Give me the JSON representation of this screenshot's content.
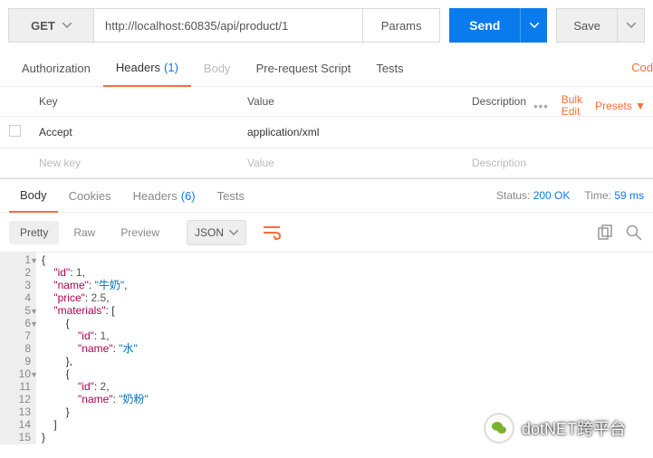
{
  "toolbar": {
    "method": "GET",
    "url": "http://localhost:60835/api/product/1",
    "params_label": "Params",
    "send_label": "Send",
    "save_label": "Save"
  },
  "request_tabs": {
    "authorization": "Authorization",
    "headers": "Headers",
    "headers_count": "(1)",
    "body": "Body",
    "prerequest": "Pre-request Script",
    "tests": "Tests",
    "code_link": "Cod"
  },
  "header_table": {
    "col_key": "Key",
    "col_value": "Value",
    "col_desc": "Description",
    "bulk_edit": "Bulk\nEdit",
    "presets": "Presets ▼",
    "rows": [
      {
        "key": "Accept",
        "value": "application/xml",
        "desc": ""
      }
    ],
    "placeholder": {
      "key": "New key",
      "value": "Value",
      "desc": "Description"
    }
  },
  "response_tabs": {
    "body": "Body",
    "cookies": "Cookies",
    "headers": "Headers",
    "headers_count": "(6)",
    "tests": "Tests",
    "status_label": "Status:",
    "status_value": "200 OK",
    "time_label": "Time:",
    "time_value": "59 ms"
  },
  "view_bar": {
    "pretty": "Pretty",
    "raw": "Raw",
    "preview": "Preview",
    "format": "JSON"
  },
  "code_lines": [
    [
      [
        "punc",
        "{"
      ]
    ],
    [
      [
        "ind",
        "    "
      ],
      [
        "key",
        "\"id\""
      ],
      [
        "punc",
        ": "
      ],
      [
        "num",
        "1"
      ],
      [
        "punc",
        ","
      ]
    ],
    [
      [
        "ind",
        "    "
      ],
      [
        "key",
        "\"name\""
      ],
      [
        "punc",
        ": "
      ],
      [
        "str",
        "\"牛奶\""
      ],
      [
        "punc",
        ","
      ]
    ],
    [
      [
        "ind",
        "    "
      ],
      [
        "key",
        "\"price\""
      ],
      [
        "punc",
        ": "
      ],
      [
        "num",
        "2.5"
      ],
      [
        "punc",
        ","
      ]
    ],
    [
      [
        "ind",
        "    "
      ],
      [
        "key",
        "\"materials\""
      ],
      [
        "punc",
        ": ["
      ]
    ],
    [
      [
        "ind",
        "        "
      ],
      [
        "punc",
        "{"
      ]
    ],
    [
      [
        "ind",
        "            "
      ],
      [
        "key",
        "\"id\""
      ],
      [
        "punc",
        ": "
      ],
      [
        "num",
        "1"
      ],
      [
        "punc",
        ","
      ]
    ],
    [
      [
        "ind",
        "            "
      ],
      [
        "key",
        "\"name\""
      ],
      [
        "punc",
        ": "
      ],
      [
        "str",
        "\"水\""
      ]
    ],
    [
      [
        "ind",
        "        "
      ],
      [
        "punc",
        "},"
      ]
    ],
    [
      [
        "ind",
        "        "
      ],
      [
        "punc",
        "{"
      ]
    ],
    [
      [
        "ind",
        "            "
      ],
      [
        "key",
        "\"id\""
      ],
      [
        "punc",
        ": "
      ],
      [
        "num",
        "2"
      ],
      [
        "punc",
        ","
      ]
    ],
    [
      [
        "ind",
        "            "
      ],
      [
        "key",
        "\"name\""
      ],
      [
        "punc",
        ": "
      ],
      [
        "str",
        "\"奶粉\""
      ]
    ],
    [
      [
        "ind",
        "        "
      ],
      [
        "punc",
        "}"
      ]
    ],
    [
      [
        "ind",
        "    "
      ],
      [
        "punc",
        "]"
      ]
    ],
    [
      [
        "punc",
        "}"
      ]
    ]
  ],
  "fold_lines": [
    1,
    5,
    6,
    10
  ],
  "watermark": "dotNET跨平台",
  "chart_data": {
    "type": "table",
    "title": "Response body JSON",
    "payload": {
      "id": 1,
      "name": "牛奶",
      "price": 2.5,
      "materials": [
        {
          "id": 1,
          "name": "水"
        },
        {
          "id": 2,
          "name": "奶粉"
        }
      ]
    }
  }
}
